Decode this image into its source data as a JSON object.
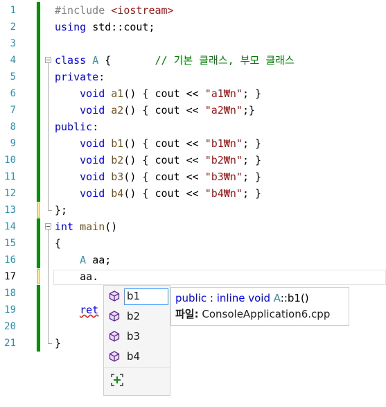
{
  "editor": {
    "line_numbers": [
      "1",
      "2",
      "3",
      "4",
      "5",
      "6",
      "7",
      "8",
      "9",
      "10",
      "11",
      "12",
      "13",
      "14",
      "15",
      "16",
      "17",
      "18",
      "19",
      "20",
      "21"
    ],
    "current_line": "17",
    "lines": [
      [
        [
          "pp",
          "#include "
        ],
        [
          "str",
          "<iostream>"
        ]
      ],
      [
        [
          "kw",
          "using "
        ],
        [
          "plain",
          "std::cout;"
        ]
      ],
      [],
      [
        [
          "kw",
          "class "
        ],
        [
          "type",
          "A "
        ],
        [
          "plain",
          "{       "
        ],
        [
          "cm",
          "// 기본 클래스, 부모 클래스"
        ]
      ],
      [
        [
          "kw",
          "private"
        ],
        [
          "plain",
          ":"
        ]
      ],
      [
        [
          "plain",
          "    "
        ],
        [
          "kw",
          "void "
        ],
        [
          "fn",
          "a1"
        ],
        [
          "plain",
          "() { cout << "
        ],
        [
          "str",
          "\"a1₩n\""
        ],
        [
          "plain",
          "; }"
        ]
      ],
      [
        [
          "plain",
          "    "
        ],
        [
          "kw",
          "void "
        ],
        [
          "fn",
          "a2"
        ],
        [
          "plain",
          "() { cout << "
        ],
        [
          "str",
          "\"a2₩n\""
        ],
        [
          "plain",
          ";}"
        ]
      ],
      [
        [
          "kw",
          "public"
        ],
        [
          "plain",
          ":"
        ]
      ],
      [
        [
          "plain",
          "    "
        ],
        [
          "kw",
          "void "
        ],
        [
          "fn",
          "b1"
        ],
        [
          "plain",
          "() { cout << "
        ],
        [
          "str",
          "\"b1₩n\""
        ],
        [
          "plain",
          "; }"
        ]
      ],
      [
        [
          "plain",
          "    "
        ],
        [
          "kw",
          "void "
        ],
        [
          "fn",
          "b2"
        ],
        [
          "plain",
          "() { cout << "
        ],
        [
          "str",
          "\"b2₩n\""
        ],
        [
          "plain",
          "; }"
        ]
      ],
      [
        [
          "plain",
          "    "
        ],
        [
          "kw",
          "void "
        ],
        [
          "fn",
          "b3"
        ],
        [
          "plain",
          "() { cout << "
        ],
        [
          "str",
          "\"b3₩n\""
        ],
        [
          "plain",
          "; }"
        ]
      ],
      [
        [
          "plain",
          "    "
        ],
        [
          "kw",
          "void "
        ],
        [
          "fn",
          "b4"
        ],
        [
          "plain",
          "() { cout << "
        ],
        [
          "str",
          "\"b4₩n\""
        ],
        [
          "plain",
          "; }"
        ]
      ],
      [
        [
          "plain",
          "};"
        ]
      ],
      [
        [
          "kw",
          "int "
        ],
        [
          "fn",
          "main"
        ],
        [
          "plain",
          "()"
        ]
      ],
      [
        [
          "plain",
          "{"
        ]
      ],
      [
        [
          "plain",
          "    "
        ],
        [
          "type",
          "A "
        ],
        [
          "plain",
          "aa;"
        ]
      ],
      [
        [
          "plain",
          "    aa."
        ]
      ],
      [],
      [
        [
          "plain",
          "    "
        ],
        [
          "kw",
          "ret"
        ]
      ],
      [],
      [
        [
          "plain",
          "}"
        ]
      ]
    ],
    "colors": {
      "line_number": "#2b91af",
      "change_saved": "#108c10",
      "change_unsaved": "#f0c14b",
      "keyword": "#0000ff",
      "type": "#2b91af",
      "string": "#a31515",
      "comment": "#008000"
    }
  },
  "completion": {
    "items": [
      {
        "label": "b1",
        "icon": "method-cube-icon",
        "selected": true
      },
      {
        "label": "b2",
        "icon": "method-cube-icon",
        "selected": false
      },
      {
        "label": "b3",
        "icon": "method-cube-icon",
        "selected": false
      },
      {
        "label": "b4",
        "icon": "method-cube-icon",
        "selected": false
      }
    ],
    "filter_icon": "expand-filter-icon"
  },
  "tooltip": {
    "access": "public",
    "separator": " : ",
    "modifiers": "inline void ",
    "class_name": "A",
    "scope_op": "::",
    "member": "b1()",
    "file_label": "파일:",
    "file_name": " ConsoleApplication6.cpp"
  }
}
